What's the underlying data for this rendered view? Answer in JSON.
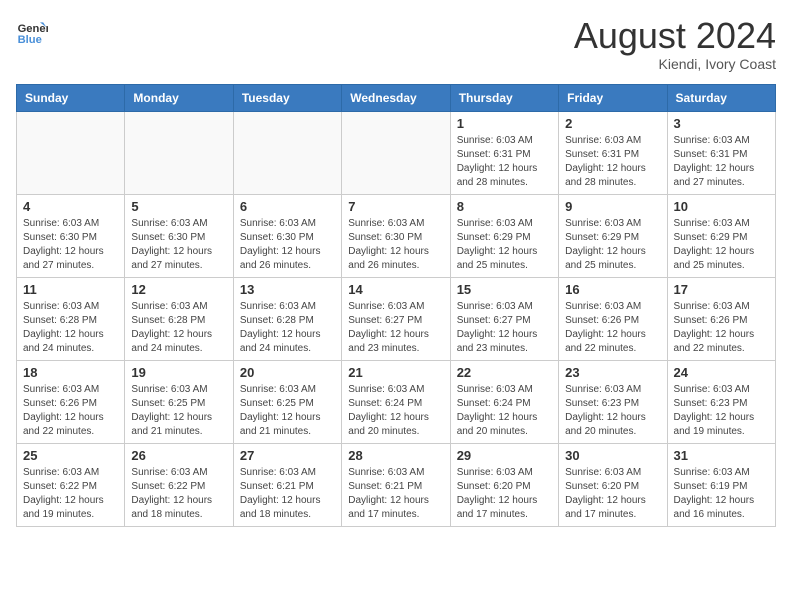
{
  "header": {
    "logo_line1": "General",
    "logo_line2": "Blue",
    "month_title": "August 2024",
    "location": "Kiendi, Ivory Coast"
  },
  "weekdays": [
    "Sunday",
    "Monday",
    "Tuesday",
    "Wednesday",
    "Thursday",
    "Friday",
    "Saturday"
  ],
  "weeks": [
    [
      {
        "day": "",
        "info": ""
      },
      {
        "day": "",
        "info": ""
      },
      {
        "day": "",
        "info": ""
      },
      {
        "day": "",
        "info": ""
      },
      {
        "day": "1",
        "info": "Sunrise: 6:03 AM\nSunset: 6:31 PM\nDaylight: 12 hours\nand 28 minutes."
      },
      {
        "day": "2",
        "info": "Sunrise: 6:03 AM\nSunset: 6:31 PM\nDaylight: 12 hours\nand 28 minutes."
      },
      {
        "day": "3",
        "info": "Sunrise: 6:03 AM\nSunset: 6:31 PM\nDaylight: 12 hours\nand 27 minutes."
      }
    ],
    [
      {
        "day": "4",
        "info": "Sunrise: 6:03 AM\nSunset: 6:30 PM\nDaylight: 12 hours\nand 27 minutes."
      },
      {
        "day": "5",
        "info": "Sunrise: 6:03 AM\nSunset: 6:30 PM\nDaylight: 12 hours\nand 27 minutes."
      },
      {
        "day": "6",
        "info": "Sunrise: 6:03 AM\nSunset: 6:30 PM\nDaylight: 12 hours\nand 26 minutes."
      },
      {
        "day": "7",
        "info": "Sunrise: 6:03 AM\nSunset: 6:30 PM\nDaylight: 12 hours\nand 26 minutes."
      },
      {
        "day": "8",
        "info": "Sunrise: 6:03 AM\nSunset: 6:29 PM\nDaylight: 12 hours\nand 25 minutes."
      },
      {
        "day": "9",
        "info": "Sunrise: 6:03 AM\nSunset: 6:29 PM\nDaylight: 12 hours\nand 25 minutes."
      },
      {
        "day": "10",
        "info": "Sunrise: 6:03 AM\nSunset: 6:29 PM\nDaylight: 12 hours\nand 25 minutes."
      }
    ],
    [
      {
        "day": "11",
        "info": "Sunrise: 6:03 AM\nSunset: 6:28 PM\nDaylight: 12 hours\nand 24 minutes."
      },
      {
        "day": "12",
        "info": "Sunrise: 6:03 AM\nSunset: 6:28 PM\nDaylight: 12 hours\nand 24 minutes."
      },
      {
        "day": "13",
        "info": "Sunrise: 6:03 AM\nSunset: 6:28 PM\nDaylight: 12 hours\nand 24 minutes."
      },
      {
        "day": "14",
        "info": "Sunrise: 6:03 AM\nSunset: 6:27 PM\nDaylight: 12 hours\nand 23 minutes."
      },
      {
        "day": "15",
        "info": "Sunrise: 6:03 AM\nSunset: 6:27 PM\nDaylight: 12 hours\nand 23 minutes."
      },
      {
        "day": "16",
        "info": "Sunrise: 6:03 AM\nSunset: 6:26 PM\nDaylight: 12 hours\nand 22 minutes."
      },
      {
        "day": "17",
        "info": "Sunrise: 6:03 AM\nSunset: 6:26 PM\nDaylight: 12 hours\nand 22 minutes."
      }
    ],
    [
      {
        "day": "18",
        "info": "Sunrise: 6:03 AM\nSunset: 6:26 PM\nDaylight: 12 hours\nand 22 minutes."
      },
      {
        "day": "19",
        "info": "Sunrise: 6:03 AM\nSunset: 6:25 PM\nDaylight: 12 hours\nand 21 minutes."
      },
      {
        "day": "20",
        "info": "Sunrise: 6:03 AM\nSunset: 6:25 PM\nDaylight: 12 hours\nand 21 minutes."
      },
      {
        "day": "21",
        "info": "Sunrise: 6:03 AM\nSunset: 6:24 PM\nDaylight: 12 hours\nand 20 minutes."
      },
      {
        "day": "22",
        "info": "Sunrise: 6:03 AM\nSunset: 6:24 PM\nDaylight: 12 hours\nand 20 minutes."
      },
      {
        "day": "23",
        "info": "Sunrise: 6:03 AM\nSunset: 6:23 PM\nDaylight: 12 hours\nand 20 minutes."
      },
      {
        "day": "24",
        "info": "Sunrise: 6:03 AM\nSunset: 6:23 PM\nDaylight: 12 hours\nand 19 minutes."
      }
    ],
    [
      {
        "day": "25",
        "info": "Sunrise: 6:03 AM\nSunset: 6:22 PM\nDaylight: 12 hours\nand 19 minutes."
      },
      {
        "day": "26",
        "info": "Sunrise: 6:03 AM\nSunset: 6:22 PM\nDaylight: 12 hours\nand 18 minutes."
      },
      {
        "day": "27",
        "info": "Sunrise: 6:03 AM\nSunset: 6:21 PM\nDaylight: 12 hours\nand 18 minutes."
      },
      {
        "day": "28",
        "info": "Sunrise: 6:03 AM\nSunset: 6:21 PM\nDaylight: 12 hours\nand 17 minutes."
      },
      {
        "day": "29",
        "info": "Sunrise: 6:03 AM\nSunset: 6:20 PM\nDaylight: 12 hours\nand 17 minutes."
      },
      {
        "day": "30",
        "info": "Sunrise: 6:03 AM\nSunset: 6:20 PM\nDaylight: 12 hours\nand 17 minutes."
      },
      {
        "day": "31",
        "info": "Sunrise: 6:03 AM\nSunset: 6:19 PM\nDaylight: 12 hours\nand 16 minutes."
      }
    ]
  ]
}
